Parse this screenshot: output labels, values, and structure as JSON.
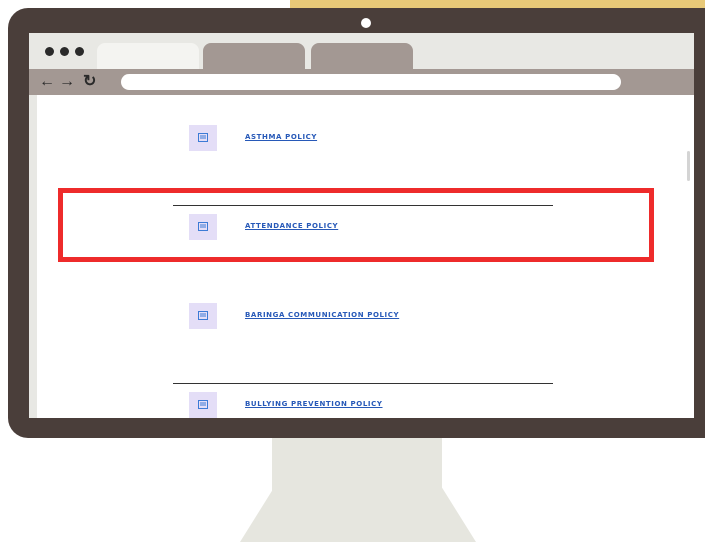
{
  "policies": {
    "items": [
      {
        "label": "ASTHMA POLICY",
        "icon": "document-icon"
      },
      {
        "label": "ATTENDANCE POLICY",
        "icon": "document-icon"
      },
      {
        "label": "BARINGA COMMUNICATION POLICY",
        "icon": "document-icon"
      },
      {
        "label": "BULLYING PREVENTION POLICY",
        "icon": "document-icon"
      }
    ]
  },
  "browser": {
    "url": "",
    "icons": [
      "back-arrow-icon",
      "forward-arrow-icon",
      "reload-icon"
    ]
  },
  "colors": {
    "link": "#2759b8",
    "highlight": "#ee2b2b",
    "icon_bg": "#e4def7",
    "monitor_frame": "#4a3e3a",
    "accent": "#e8c978"
  }
}
